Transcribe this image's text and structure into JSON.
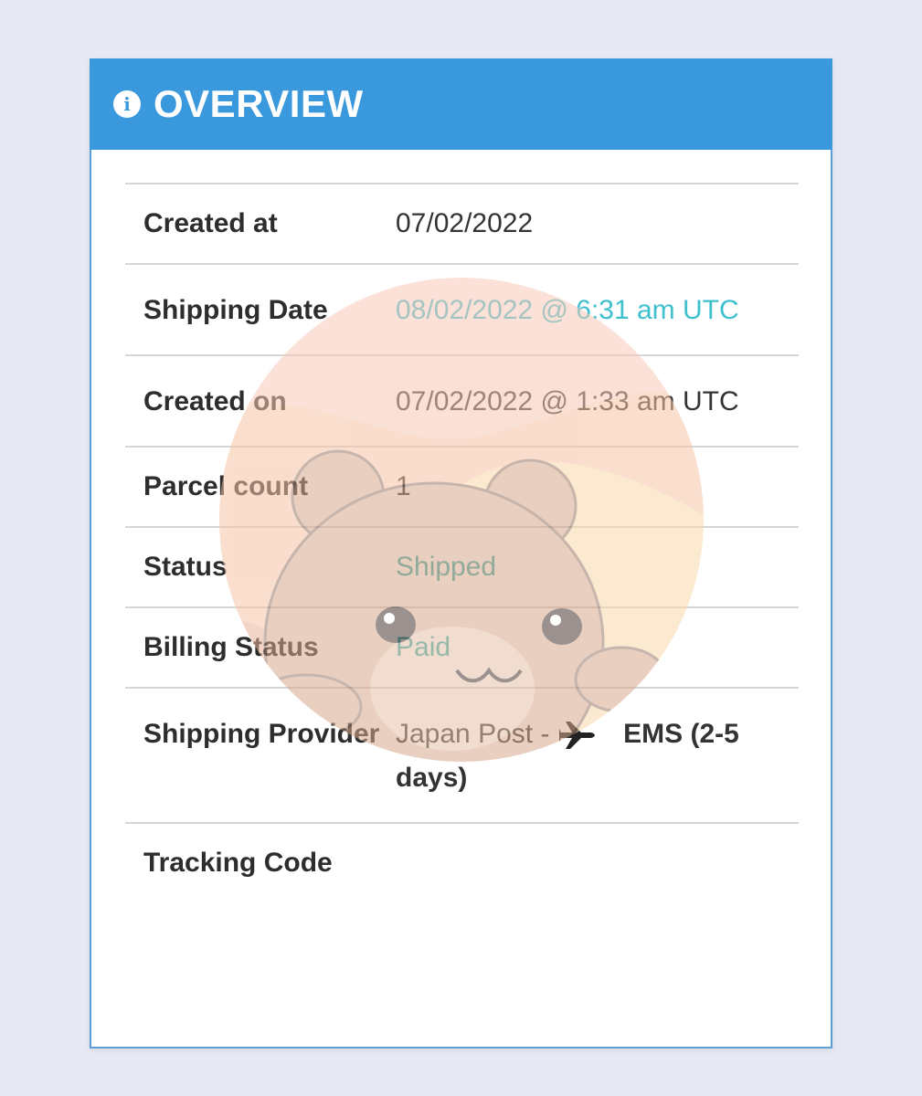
{
  "header": {
    "icon": "info-icon",
    "title": "OVERVIEW"
  },
  "rows": [
    {
      "label": "Created at",
      "value": "07/02/2022"
    },
    {
      "label": "Shipping Date",
      "value": "08/02/2022 @ 6:31 am UTC"
    },
    {
      "label": "Created on",
      "value": "07/02/2022 @ 1:33 am UTC"
    },
    {
      "label": "Parcel count",
      "value": "1"
    },
    {
      "label": "Status",
      "value": "Shipped"
    },
    {
      "label": "Billing Status",
      "value": "Paid"
    },
    {
      "label": "Shipping Provider",
      "value_prefix": "Japan Post -",
      "value_icon": "airplane-icon",
      "value_service": "EMS (2-5 days)"
    },
    {
      "label": "Tracking Code",
      "value": ""
    }
  ],
  "colors": {
    "header_bg": "#3a98dc",
    "link_value": "#3fc0cf",
    "status_value": "#3aaeaa",
    "panel_border": "#5d9fd8"
  },
  "watermark": {
    "icon": "bear-mascot-watermark"
  }
}
